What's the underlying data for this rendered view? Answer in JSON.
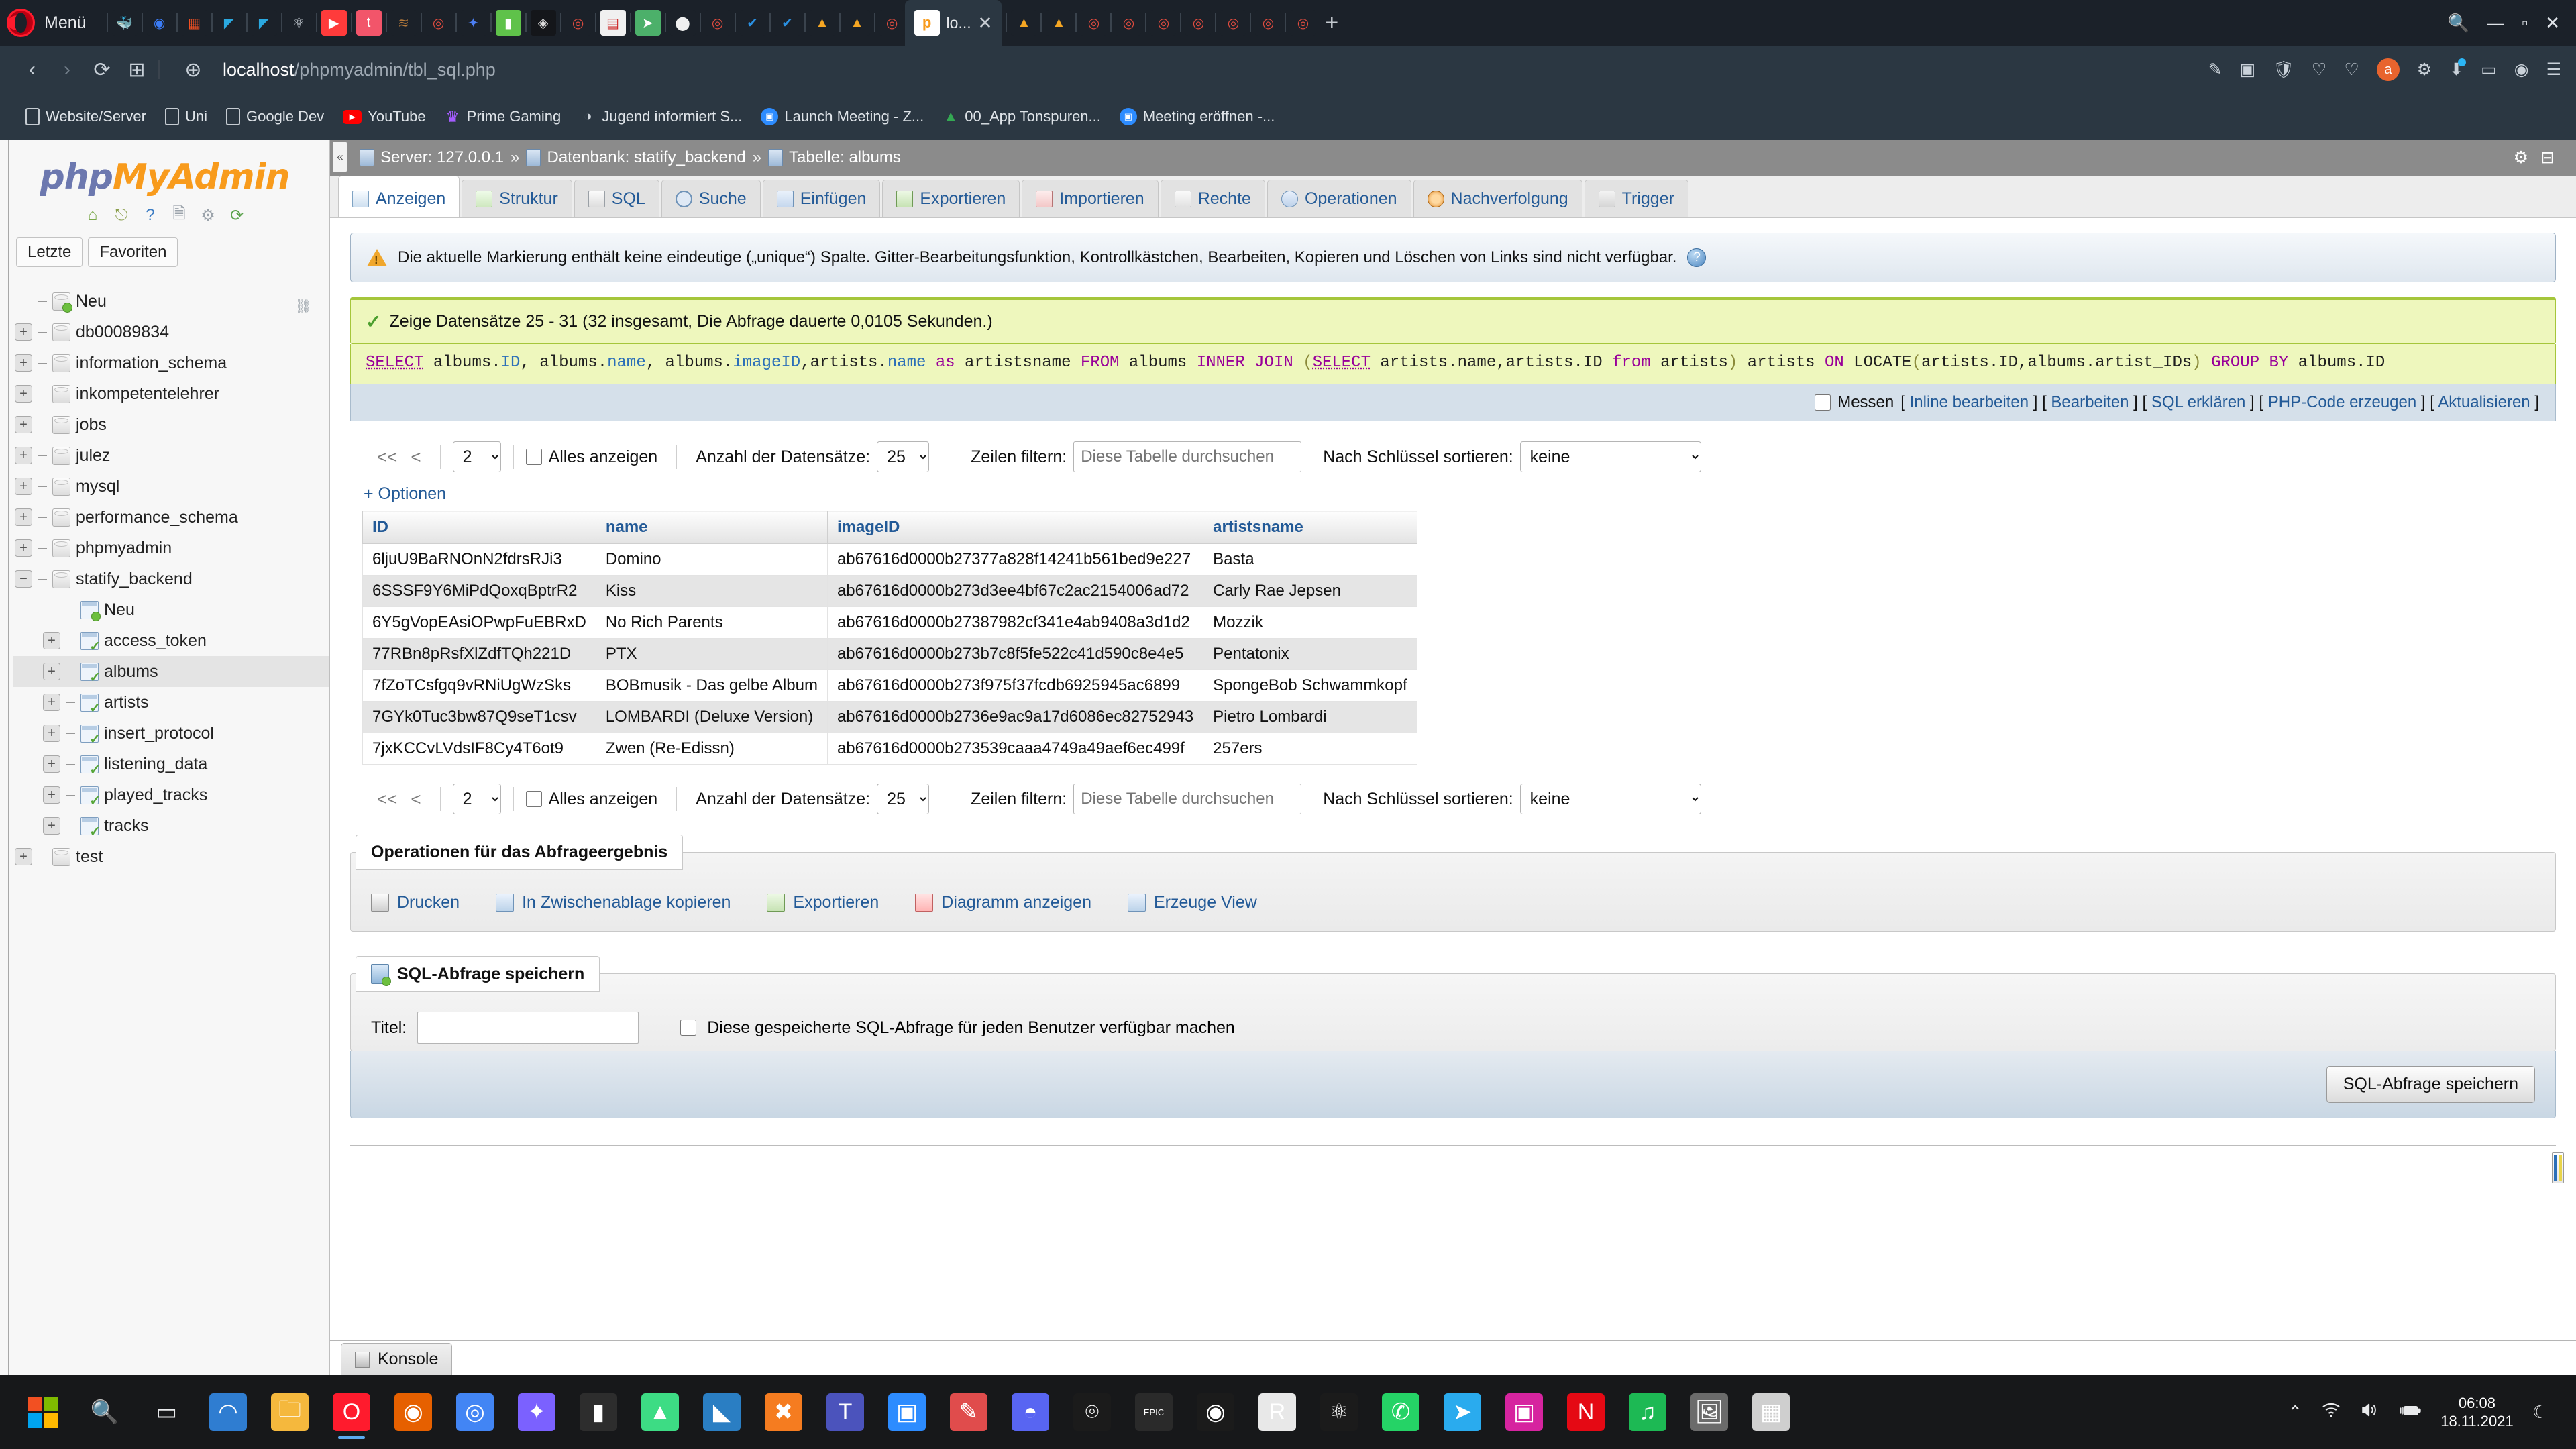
{
  "browser": {
    "menu_label": "Menü",
    "tabs": [
      {
        "name": "docker-icon",
        "glyph": "🐳",
        "bg": "#1b2129",
        "color": "#d7dde3"
      },
      {
        "name": "ionic-icon",
        "glyph": "◉",
        "bg": "#1b2129",
        "color": "#3b7cf6"
      },
      {
        "name": "microsoft-icon",
        "glyph": "▦",
        "bg": "#1b2129",
        "color": "#f25022"
      },
      {
        "name": "flutter-icon",
        "glyph": "◤",
        "bg": "#1b2129",
        "color": "#2aa9e0"
      },
      {
        "name": "flutter-icon-2",
        "glyph": "◤",
        "bg": "#1b2129",
        "color": "#2aa9e0"
      },
      {
        "name": "react-icon",
        "glyph": "⚛",
        "bg": "#1b2129",
        "color": "#cfd6dd"
      },
      {
        "name": "youtube-icon",
        "glyph": "▶",
        "bg": "#ff3b3b",
        "color": "#ffffff"
      },
      {
        "name": "pintrest-icon",
        "glyph": "t",
        "bg": "#f2556a",
        "color": "#ffffff"
      },
      {
        "name": "wood-icon",
        "glyph": "≋",
        "bg": "#1b2129",
        "color": "#b5793a"
      },
      {
        "name": "chrome-icon",
        "glyph": "◎",
        "bg": "#1b2129",
        "color": "#e24c3f"
      },
      {
        "name": "confetti-icon",
        "glyph": "✦",
        "bg": "#1b2129",
        "color": "#4c7ef3"
      },
      {
        "name": "green-note-icon",
        "glyph": "▮",
        "bg": "#5fc24a",
        "color": "#ffffff"
      },
      {
        "name": "gem-icon",
        "glyph": "◈",
        "bg": "#14161a",
        "color": "#dcdcdc"
      },
      {
        "name": "chrome-icon-2",
        "glyph": "◎",
        "bg": "#1b2129",
        "color": "#e24c3f"
      },
      {
        "name": "sublime-icon",
        "glyph": "▤",
        "bg": "#f0f0f0",
        "color": "#cc2222"
      },
      {
        "name": "telegram-icon",
        "glyph": "➤",
        "bg": "#4cb06a",
        "color": "#ffffff"
      },
      {
        "name": "github-icon",
        "glyph": "⬤",
        "bg": "#1b2129",
        "color": "#f0f0f0"
      },
      {
        "name": "chrome-icon-3",
        "glyph": "◎",
        "bg": "#1b2129",
        "color": "#e24c3f"
      },
      {
        "name": "azure-icon",
        "glyph": "✔",
        "bg": "#1b2129",
        "color": "#2a8fe0"
      },
      {
        "name": "azure-icon-2",
        "glyph": "✔",
        "bg": "#1b2129",
        "color": "#2a8fe0"
      },
      {
        "name": "firebase-icon",
        "glyph": "▲",
        "bg": "#1b2129",
        "color": "#f5a623"
      },
      {
        "name": "firebase-icon-2",
        "glyph": "▲",
        "bg": "#1b2129",
        "color": "#f5a623"
      },
      {
        "name": "chrome-icon-4",
        "glyph": "◎",
        "bg": "#1b2129",
        "color": "#e24c3f"
      }
    ],
    "tabs_after": [
      {
        "name": "firebase-icon-3",
        "glyph": "▲",
        "bg": "#1b2129",
        "color": "#f5a623"
      },
      {
        "name": "firebase-icon-4",
        "glyph": "▲",
        "bg": "#1b2129",
        "color": "#f5a623"
      },
      {
        "name": "chrome-icon-5",
        "glyph": "◎",
        "bg": "#1b2129",
        "color": "#e24c3f"
      },
      {
        "name": "chrome-icon-6",
        "glyph": "◎",
        "bg": "#1b2129",
        "color": "#e24c3f"
      },
      {
        "name": "chrome-icon-7",
        "glyph": "◎",
        "bg": "#1b2129",
        "color": "#e24c3f"
      },
      {
        "name": "chrome-icon-8",
        "glyph": "◎",
        "bg": "#1b2129",
        "color": "#e24c3f"
      },
      {
        "name": "chrome-icon-9",
        "glyph": "◎",
        "bg": "#1b2129",
        "color": "#e24c3f"
      },
      {
        "name": "chrome-icon-10",
        "glyph": "◎",
        "bg": "#1b2129",
        "color": "#e24c3f"
      },
      {
        "name": "chrome-icon-11",
        "glyph": "◎",
        "bg": "#1b2129",
        "color": "#e24c3f"
      }
    ],
    "active_tab_label": "lo...",
    "active_tab_close": "✕",
    "new_tab": "+",
    "window_buttons": {
      "search": "🔍",
      "minimize": "—",
      "maximize": "▫",
      "close": "✕"
    },
    "nav": {
      "back": "‹",
      "forward": "›",
      "reload": "⟳",
      "apps": "⊞",
      "globe": "⊕"
    },
    "url_bold": "localhost",
    "url_rest": "/phpmyadmin/tbl_sql.php",
    "toolbar_right": [
      "✎",
      "▣",
      "🛡",
      "♡",
      "♡",
      "a",
      "⚙",
      "⬇",
      "▭",
      "◉",
      "☰"
    ],
    "bookmarks": [
      {
        "label": "Website/Server",
        "icon": "page"
      },
      {
        "label": "Uni",
        "icon": "page"
      },
      {
        "label": "Google Dev",
        "icon": "page"
      },
      {
        "label": "YouTube",
        "icon": "youtube"
      },
      {
        "label": "Prime Gaming",
        "icon": "prime"
      },
      {
        "label": "Jugend informiert S...",
        "icon": "speaker"
      },
      {
        "label": "Launch Meeting - Z...",
        "icon": "zoom"
      },
      {
        "label": "00_App Tonspuren...",
        "icon": "drive"
      },
      {
        "label": "Meeting eröffnen -...",
        "icon": "zoom"
      }
    ]
  },
  "sidebar": {
    "logo_php": "php",
    "logo_my": "MyAdmin",
    "icons": [
      {
        "name": "home-icon",
        "glyph": "🏠"
      },
      {
        "name": "logout-icon",
        "glyph": "🚪"
      },
      {
        "name": "help-icon",
        "glyph": "?"
      },
      {
        "name": "docs-icon",
        "glyph": "🗎"
      },
      {
        "name": "settings-gear-icon",
        "glyph": "⚙"
      },
      {
        "name": "reload-icon",
        "glyph": "⟳"
      }
    ],
    "tabs": [
      {
        "label": "Letzte"
      },
      {
        "label": "Favoriten"
      }
    ],
    "chain_icon": "⛓",
    "tree": [
      {
        "label": "Neu",
        "type": "new-db",
        "indent": 0,
        "expander": "none",
        "selected": false
      },
      {
        "label": "db00089834",
        "type": "db",
        "indent": 0,
        "expander": "+",
        "selected": false
      },
      {
        "label": "information_schema",
        "type": "db",
        "indent": 0,
        "expander": "+",
        "selected": false
      },
      {
        "label": "inkompetentelehrer",
        "type": "db",
        "indent": 0,
        "expander": "+",
        "selected": false
      },
      {
        "label": "jobs",
        "type": "db",
        "indent": 0,
        "expander": "+",
        "selected": false
      },
      {
        "label": "julez",
        "type": "db",
        "indent": 0,
        "expander": "+",
        "selected": false
      },
      {
        "label": "mysql",
        "type": "db",
        "indent": 0,
        "expander": "+",
        "selected": false
      },
      {
        "label": "performance_schema",
        "type": "db",
        "indent": 0,
        "expander": "+",
        "selected": false
      },
      {
        "label": "phpmyadmin",
        "type": "db",
        "indent": 0,
        "expander": "+",
        "selected": false
      },
      {
        "label": "statify_backend",
        "type": "db",
        "indent": 0,
        "expander": "−",
        "selected": false
      },
      {
        "label": "Neu",
        "type": "new-table",
        "indent": 1,
        "expander": "none",
        "selected": false
      },
      {
        "label": "access_token",
        "type": "table",
        "indent": 1,
        "expander": "+",
        "selected": false
      },
      {
        "label": "albums",
        "type": "table",
        "indent": 1,
        "expander": "+",
        "selected": true
      },
      {
        "label": "artists",
        "type": "table",
        "indent": 1,
        "expander": "+",
        "selected": false
      },
      {
        "label": "insert_protocol",
        "type": "table",
        "indent": 1,
        "expander": "+",
        "selected": false
      },
      {
        "label": "listening_data",
        "type": "table",
        "indent": 1,
        "expander": "+",
        "selected": false
      },
      {
        "label": "played_tracks",
        "type": "table",
        "indent": 1,
        "expander": "+",
        "selected": false
      },
      {
        "label": "tracks",
        "type": "table",
        "indent": 1,
        "expander": "+",
        "selected": false
      },
      {
        "label": "test",
        "type": "db",
        "indent": 0,
        "expander": "+",
        "selected": false
      }
    ]
  },
  "breadcrumb": {
    "collapse_icon": "«",
    "server": "Server: 127.0.0.1",
    "sep1": "»",
    "database": "Datenbank: statify_backend",
    "sep2": "»",
    "table": "Tabelle: albums",
    "settings_icon": "⚙",
    "help_icon": "⊟"
  },
  "tabs": [
    {
      "label": "Anzeigen",
      "icon": "i-view",
      "active": true
    },
    {
      "label": "Struktur",
      "icon": "i-struct",
      "active": false
    },
    {
      "label": "SQL",
      "icon": "i-sql",
      "active": false
    },
    {
      "label": "Suche",
      "icon": "i-search",
      "active": false
    },
    {
      "label": "Einfügen",
      "icon": "i-insert",
      "active": false
    },
    {
      "label": "Exportieren",
      "icon": "i-export",
      "active": false
    },
    {
      "label": "Importieren",
      "icon": "i-import",
      "active": false
    },
    {
      "label": "Rechte",
      "icon": "i-rights",
      "active": false
    },
    {
      "label": "Operationen",
      "icon": "i-oper",
      "active": false
    },
    {
      "label": "Nachverfolgung",
      "icon": "i-track",
      "active": false
    },
    {
      "label": "Trigger",
      "icon": "i-trigger",
      "active": false
    }
  ],
  "warning": {
    "text": "Die aktuelle Markierung enthält keine eindeutige („unique“) Spalte. Gitter-Bearbeitungsfunktion, Kontrollkästchen, Bearbeiten, Kopieren und Löschen von Links sind nicht verfügbar.",
    "help_glyph": "?"
  },
  "success": {
    "check": "✓",
    "text": "Zeige Datensätze 25 - 31 (32 insgesamt, Die Abfrage dauerte 0,0105 Sekunden.)"
  },
  "sql": {
    "full": "SELECT albums.ID, albums.name, albums.imageID,artists.name as artistsname FROM albums INNER JOIN (SELECT artists.name,artists.ID from artists) artists ON LOCATE(artists.ID,albums.artist_IDs) GROUP BY albums.ID",
    "tokens": [
      {
        "t": "SELECT",
        "c": "kw u"
      },
      {
        "t": " ",
        "c": ""
      },
      {
        "t": "albums",
        "c": "id"
      },
      {
        "t": ".",
        "c": "id"
      },
      {
        "t": "ID",
        "c": "col"
      },
      {
        "t": ", ",
        "c": "id"
      },
      {
        "t": "albums",
        "c": "id"
      },
      {
        "t": ".",
        "c": "id"
      },
      {
        "t": "name",
        "c": "col"
      },
      {
        "t": ", ",
        "c": "id"
      },
      {
        "t": "albums",
        "c": "id"
      },
      {
        "t": ".",
        "c": "id"
      },
      {
        "t": "imageID",
        "c": "col"
      },
      {
        "t": ",",
        "c": "id"
      },
      {
        "t": "artists",
        "c": "id"
      },
      {
        "t": ".",
        "c": "id"
      },
      {
        "t": "name",
        "c": "col"
      },
      {
        "t": " ",
        "c": ""
      },
      {
        "t": "as",
        "c": "kw"
      },
      {
        "t": " artistsname ",
        "c": "id"
      },
      {
        "t": "FROM",
        "c": "kw"
      },
      {
        "t": " albums ",
        "c": "id"
      },
      {
        "t": "INNER JOIN",
        "c": "kw"
      },
      {
        "t": " ",
        "c": ""
      },
      {
        "t": "(",
        "c": "paren"
      },
      {
        "t": "SELECT",
        "c": "kw u"
      },
      {
        "t": " ",
        "c": ""
      },
      {
        "t": "artists",
        "c": "id"
      },
      {
        "t": ".",
        "c": "id"
      },
      {
        "t": "name",
        "c": "id"
      },
      {
        "t": ",",
        "c": "id"
      },
      {
        "t": "artists",
        "c": "id"
      },
      {
        "t": ".",
        "c": "id"
      },
      {
        "t": "ID",
        "c": "id"
      },
      {
        "t": " ",
        "c": ""
      },
      {
        "t": "from",
        "c": "kw"
      },
      {
        "t": " artists",
        "c": "id"
      },
      {
        "t": ")",
        "c": "paren"
      },
      {
        "t": " artists ",
        "c": "id"
      },
      {
        "t": "ON",
        "c": "kw"
      },
      {
        "t": " LOCATE",
        "c": "id"
      },
      {
        "t": "(",
        "c": "paren"
      },
      {
        "t": "artists.ID,albums.artist_IDs",
        "c": "id"
      },
      {
        "t": ")",
        "c": "paren"
      },
      {
        "t": " ",
        "c": ""
      },
      {
        "t": "GROUP BY",
        "c": "kw"
      },
      {
        "t": " albums.ID",
        "c": "id"
      }
    ]
  },
  "options_bar": {
    "profiling_label": "Messen",
    "links": [
      "Inline bearbeiten",
      "Bearbeiten",
      "SQL erklären",
      "PHP-Code erzeugen",
      "Aktualisieren"
    ],
    "bracket_open": "[",
    "bracket_close": "]"
  },
  "pager": {
    "first": "<<",
    "prev": "<",
    "page_value": "2",
    "show_all_label": "Alles anzeigen",
    "rows_label": "Anzahl der Datensätze:",
    "rows_value": "25",
    "filter_label": "Zeilen filtern:",
    "filter_placeholder": "Diese Tabelle durchsuchen",
    "sort_label": "Nach Schlüssel sortieren:",
    "sort_value": "keine"
  },
  "options_link": "+ Optionen",
  "table": {
    "columns": [
      "ID",
      "name",
      "imageID",
      "artistsname"
    ],
    "rows": [
      [
        "6ljuU9BaRNOnN2fdrsRJi3",
        "Domino",
        "ab67616d0000b27377a828f14241b561bed9e227",
        "Basta"
      ],
      [
        "6SSSF9Y6MiPdQoxqBptrR2",
        "Kiss",
        "ab67616d0000b273d3ee4bf67c2ac2154006ad72",
        "Carly Rae Jepsen"
      ],
      [
        "6Y5gVopEAsiOPwpFuEBRxD",
        "No Rich Parents",
        "ab67616d0000b27387982cf341e4ab9408a3d1d2",
        "Mozzik"
      ],
      [
        "77RBn8pRsfXlZdfTQh221D",
        "PTX",
        "ab67616d0000b273b7c8f5fe522c41d590c8e4e5",
        "Pentatonix"
      ],
      [
        "7fZoTCsfgq9vRNiUgWzSks",
        "BOBmusik - Das gelbe Album",
        "ab67616d0000b273f975f37fcdb6925945ac6899",
        "SpongeBob Schwammkopf"
      ],
      [
        "7GYk0Tuc3bw87Q9seT1csv",
        "LOMBARDI (Deluxe Version)",
        "ab67616d0000b2736e9ac9a17d6086ec82752943",
        "Pietro Lombardi"
      ],
      [
        "7jxKCCvLVdsIF8Cy4T6ot9",
        "Zwen (Re-Edissn)",
        "ab67616d0000b273539caaa4749a49aef6ec499f",
        "257ers"
      ]
    ]
  },
  "query_ops": {
    "legend": "Operationen für das Abfrageergebnis",
    "items": [
      {
        "label": "Drucken",
        "icon": "o-print"
      },
      {
        "label": "In Zwischenablage kopieren",
        "icon": "o-clip"
      },
      {
        "label": "Exportieren",
        "icon": "o-export"
      },
      {
        "label": "Diagramm anzeigen",
        "icon": "o-chart"
      },
      {
        "label": "Erzeuge View",
        "icon": "o-view"
      }
    ]
  },
  "save_query": {
    "legend": "SQL-Abfrage speichern",
    "title_label": "Titel:",
    "title_value": "",
    "share_label": "Diese gespeicherte SQL-Abfrage für jeden Benutzer verfügbar machen",
    "submit_label": "SQL-Abfrage speichern"
  },
  "console": {
    "label": "Konsole"
  },
  "taskbar": {
    "items": [
      {
        "name": "start-button",
        "glyph": "win",
        "bg": "transparent"
      },
      {
        "name": "search-button",
        "glyph": "🔍",
        "bg": "transparent"
      },
      {
        "name": "task-view-button",
        "glyph": "▭",
        "bg": "transparent"
      },
      {
        "name": "edge-icon",
        "glyph": "◠",
        "bg": "#2f7dd1"
      },
      {
        "name": "file-explorer-icon",
        "glyph": "🗀",
        "bg": "#f5b83d"
      },
      {
        "name": "opera-icon",
        "glyph": "O",
        "bg": "#ff1b2d",
        "active": true
      },
      {
        "name": "firefox-icon",
        "glyph": "◉",
        "bg": "#e66000"
      },
      {
        "name": "chrome-icon",
        "glyph": "◎",
        "bg": "#4285f4"
      },
      {
        "name": "figma-icon",
        "glyph": "✦",
        "bg": "#7b61ff"
      },
      {
        "name": "terminal-icon",
        "glyph": "▮",
        "bg": "#2d2d2d"
      },
      {
        "name": "android-studio-icon",
        "glyph": "▲",
        "bg": "#3ddc84"
      },
      {
        "name": "vscode-icon",
        "glyph": "◣",
        "bg": "#2a7ec3"
      },
      {
        "name": "xampp-icon",
        "glyph": "✖",
        "bg": "#f57c20"
      },
      {
        "name": "teams-icon",
        "glyph": "T",
        "bg": "#4b53bc"
      },
      {
        "name": "zoom-icon",
        "glyph": "▣",
        "bg": "#2d8cff"
      },
      {
        "name": "paint-icon",
        "glyph": "✎",
        "bg": "#e04c4c"
      },
      {
        "name": "discord-icon",
        "glyph": "◓",
        "bg": "#5865f2"
      },
      {
        "name": "bird-icon",
        "glyph": "⌾",
        "bg": "#1b1b1b"
      },
      {
        "name": "epic-games-icon",
        "glyph": "EPIC",
        "bg": "#2a2a2a"
      },
      {
        "name": "spotify-alt-icon",
        "glyph": "◉",
        "bg": "#1b1b1b"
      },
      {
        "name": "rstudio-icon",
        "glyph": "R",
        "bg": "#e8e8e8"
      },
      {
        "name": "atom-icon",
        "glyph": "⚛",
        "bg": "#1b1b1b"
      },
      {
        "name": "whatsapp-icon",
        "glyph": "✆",
        "bg": "#25d366"
      },
      {
        "name": "telegram-icon",
        "glyph": "➤",
        "bg": "#2aabee"
      },
      {
        "name": "instagram-icon",
        "glyph": "▣",
        "bg": "#d6249f"
      },
      {
        "name": "netflix-icon",
        "glyph": "N",
        "bg": "#e50914"
      },
      {
        "name": "spotify-icon",
        "glyph": "♫",
        "bg": "#1db954"
      },
      {
        "name": "photos-icon",
        "glyph": "🖼",
        "bg": "#6b6b6b"
      },
      {
        "name": "calculator-icon",
        "glyph": "▦",
        "bg": "#cfcfcf"
      }
    ],
    "tray": {
      "chevron": "⌃",
      "wifi": "📶",
      "volume": "🔊",
      "battery": "🔌",
      "time": "06:08",
      "date": "18.11.2021",
      "moon": "☾"
    }
  }
}
